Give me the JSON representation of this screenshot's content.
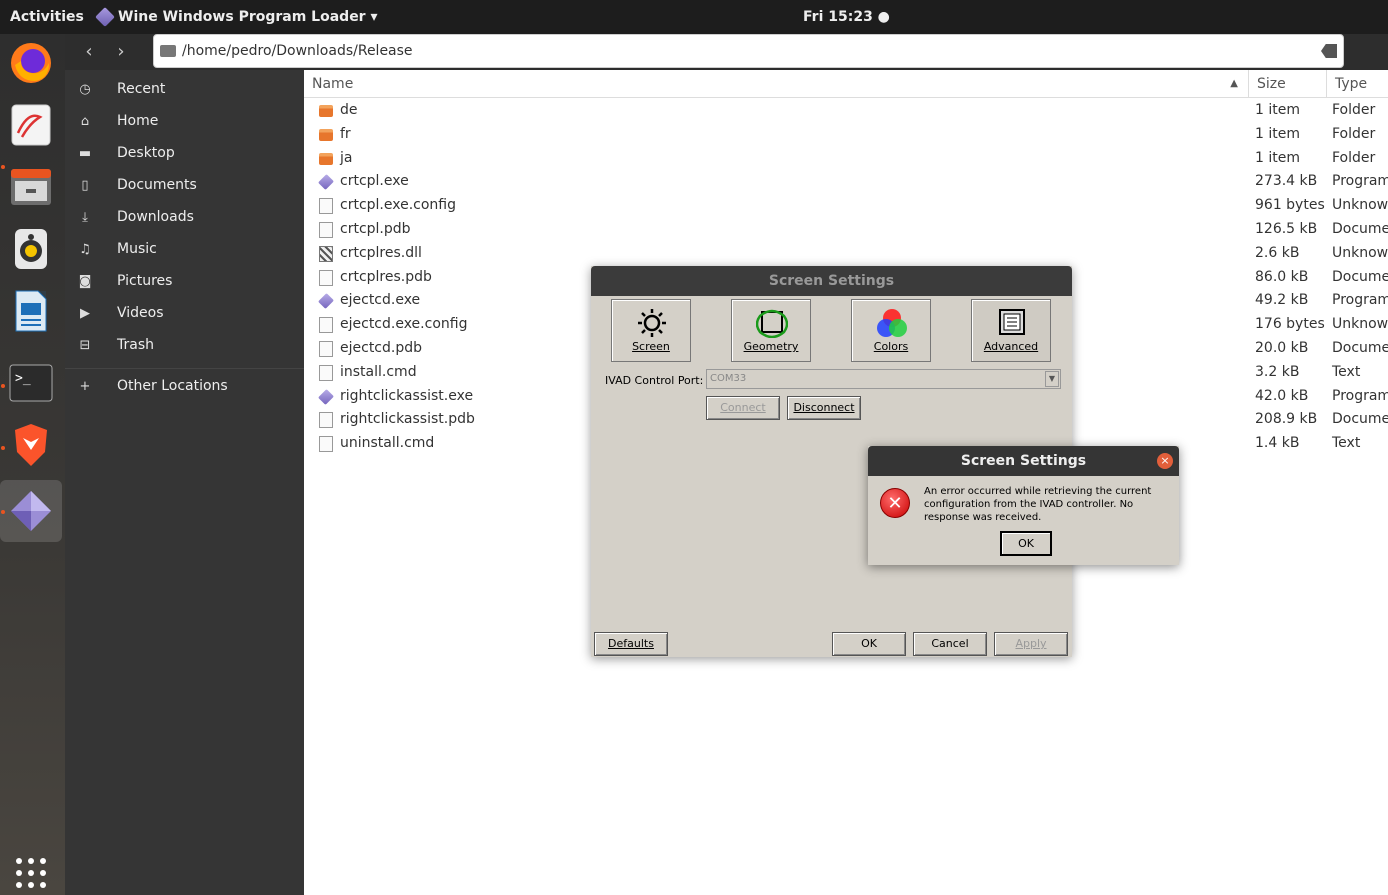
{
  "topbar": {
    "activities": "Activities",
    "app_name": "Wine Windows Program Loader ▾",
    "clock": "Fri 15:23 ●"
  },
  "dock": {
    "items": [
      "firefox-icon",
      "document-viewer-icon",
      "file-manager-icon",
      "rhythmbox-icon",
      "writer-icon",
      "terminal-icon",
      "brave-icon",
      "wine-icon"
    ],
    "colors": {
      "accent": "#e95420"
    }
  },
  "header": {
    "back": "‹",
    "forward": "›",
    "path": "/home/pedro/Downloads/Release"
  },
  "sidebar": {
    "items": [
      {
        "label": "Recent",
        "icon": "clock-icon",
        "glyph": "◷"
      },
      {
        "label": "Home",
        "icon": "home-icon",
        "glyph": "⌂"
      },
      {
        "label": "Desktop",
        "icon": "folder-icon",
        "glyph": "▬"
      },
      {
        "label": "Documents",
        "icon": "document-icon",
        "glyph": "▯"
      },
      {
        "label": "Downloads",
        "icon": "download-icon",
        "glyph": "⤓"
      },
      {
        "label": "Music",
        "icon": "music-icon",
        "glyph": "♫"
      },
      {
        "label": "Pictures",
        "icon": "camera-icon",
        "glyph": "◙"
      },
      {
        "label": "Videos",
        "icon": "video-icon",
        "glyph": "▶"
      },
      {
        "label": "Trash",
        "icon": "trash-icon",
        "glyph": "⊟"
      },
      {
        "label": "Other Locations",
        "icon": "plus-icon",
        "glyph": "+"
      }
    ]
  },
  "filelist": {
    "columns": {
      "name": "Name",
      "sort_indicator": "▲",
      "size": "Size",
      "type": "Type"
    },
    "rows": [
      {
        "name": "de",
        "size": "1 item",
        "type": "Folder",
        "kind": "folder"
      },
      {
        "name": "fr",
        "size": "1 item",
        "type": "Folder",
        "kind": "folder"
      },
      {
        "name": "ja",
        "size": "1 item",
        "type": "Folder",
        "kind": "folder"
      },
      {
        "name": "crtcpl.exe",
        "size": "273.4 kB",
        "type": "Program",
        "kind": "exe"
      },
      {
        "name": "crtcpl.exe.config",
        "size": "961 bytes",
        "type": "Unknown",
        "kind": "doc"
      },
      {
        "name": "crtcpl.pdb",
        "size": "126.5 kB",
        "type": "Document",
        "kind": "doc"
      },
      {
        "name": "crtcplres.dll",
        "size": "2.6 kB",
        "type": "Unknown",
        "kind": "dll"
      },
      {
        "name": "crtcplres.pdb",
        "size": "86.0 kB",
        "type": "Document",
        "kind": "doc"
      },
      {
        "name": "ejectcd.exe",
        "size": "49.2 kB",
        "type": "Program",
        "kind": "exe"
      },
      {
        "name": "ejectcd.exe.config",
        "size": "176 bytes",
        "type": "Unknown",
        "kind": "doc"
      },
      {
        "name": "ejectcd.pdb",
        "size": "20.0 kB",
        "type": "Document",
        "kind": "doc"
      },
      {
        "name": "install.cmd",
        "size": "3.2 kB",
        "type": "Text",
        "kind": "doc"
      },
      {
        "name": "rightclickassist.exe",
        "size": "42.0 kB",
        "type": "Program",
        "kind": "exe"
      },
      {
        "name": "rightclickassist.pdb",
        "size": "208.9 kB",
        "type": "Document",
        "kind": "doc"
      },
      {
        "name": "uninstall.cmd",
        "size": "1.4 kB",
        "type": "Text",
        "kind": "doc"
      }
    ]
  },
  "wine_dialog": {
    "title": "Screen Settings",
    "tabs": [
      {
        "label": "Screen",
        "icon": "sun-icon"
      },
      {
        "label": "Geometry",
        "icon": "geometry-icon"
      },
      {
        "label": "Colors",
        "icon": "color-wheel-icon"
      },
      {
        "label": "Advanced",
        "icon": "monitor-settings-icon"
      }
    ],
    "port_label": "IVAD Control Port:",
    "port_value": "COM33",
    "connect": "Connect",
    "disconnect": "Disconnect",
    "defaults": "Defaults",
    "ok": "OK",
    "cancel": "Cancel",
    "apply": "Apply"
  },
  "error_dialog": {
    "title": "Screen Settings",
    "message": "An error occurred while retrieving the current configuration from the IVAD controller. No response was received.",
    "ok": "OK",
    "close": "×",
    "error_glyph": "✕"
  }
}
